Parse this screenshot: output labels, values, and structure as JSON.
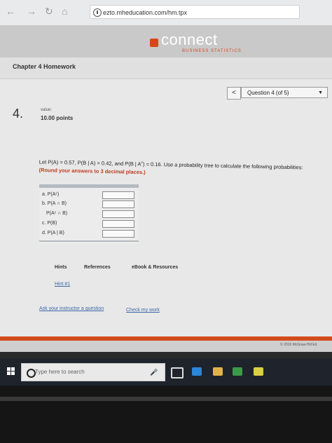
{
  "browser": {
    "url": "ezto.mheducation.com/hm.tpx"
  },
  "header": {
    "logo": "connect",
    "logo_sub": "BUSINESS STATISTICS",
    "accent": "#d8461a"
  },
  "chapter": {
    "title": "Chapter 4 Homework"
  },
  "nav": {
    "prev": "<",
    "question_select": "Question 4 (of 5)"
  },
  "question": {
    "number": "4.",
    "value_label": "value:",
    "points": "10.00 points",
    "text_intro": "Let P(A) = 0.57, P(B | A) = 0.42, and P(B | A",
    "sup_c": "c",
    "text_mid": ") = 0.16. Use a probability tree to calculate the following probabilities:",
    "round_note": "(Round your answers to 3 decimal places.)",
    "rows": [
      {
        "label": "a. P(Aᶜ)"
      },
      {
        "label": "b. P(A ∩ B)"
      },
      {
        "label": "P(Aᶜ ∩ B)"
      },
      {
        "label": "c. P(B)"
      },
      {
        "label": "d. P(A | B)"
      }
    ]
  },
  "links": {
    "hints": "Hints",
    "references": "References",
    "ebook": "eBook & Resources",
    "hint1": "Hint #1",
    "ask": "Ask your instructor a question",
    "check": "Check my work"
  },
  "footer": {
    "copyright": "© 2016 McGraw-Hill Ed."
  },
  "taskbar": {
    "search_placeholder": "Type here to search"
  }
}
